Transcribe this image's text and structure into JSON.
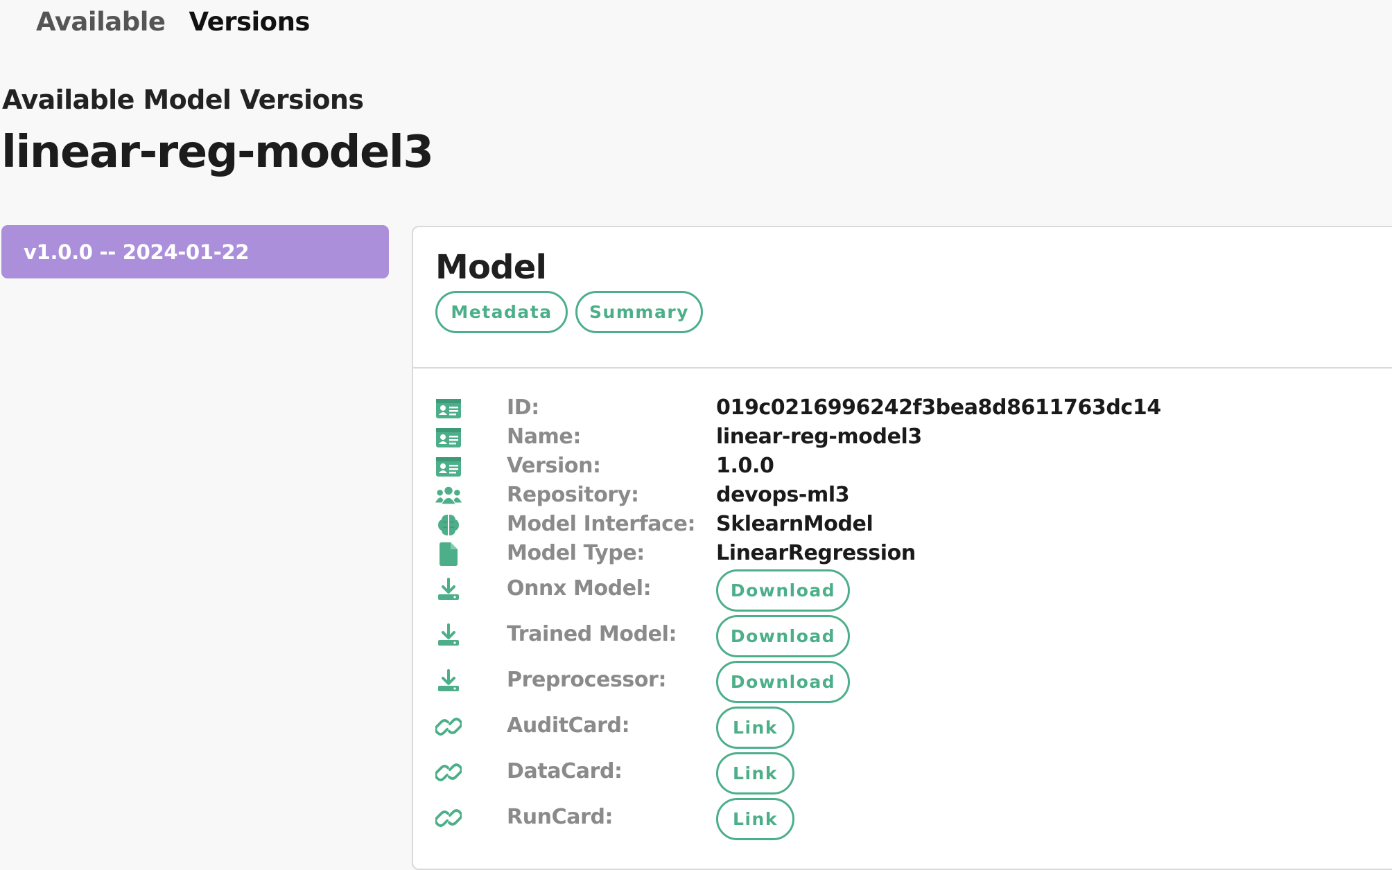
{
  "tabs": [
    {
      "label": "Available"
    },
    {
      "label": "Versions"
    }
  ],
  "page": {
    "subtitle": "Available Model Versions",
    "model_name": "linear-reg-model3"
  },
  "versions": [
    {
      "label": "v1.0.0 -- 2024-01-22",
      "selected": true
    }
  ],
  "card": {
    "title": "Model",
    "tabs": [
      {
        "label": "Metadata"
      },
      {
        "label": "Summary"
      }
    ],
    "fields": [
      {
        "icon": "id-card-icon",
        "label": "ID:",
        "value": "019c0216996242f3bea8d8611763dc14"
      },
      {
        "icon": "id-card-icon",
        "label": "Name:",
        "value": "linear-reg-model3"
      },
      {
        "icon": "id-card-icon",
        "label": "Version:",
        "value": "1.0.0"
      },
      {
        "icon": "users-icon",
        "label": "Repository:",
        "value": "devops-ml3"
      },
      {
        "icon": "brain-icon",
        "label": "Model Interface:",
        "value": "SklearnModel"
      },
      {
        "icon": "file-icon",
        "label": "Model Type:",
        "value": "LinearRegression"
      }
    ],
    "actions": [
      {
        "icon": "download-icon",
        "label": "Onnx Model:",
        "button": "Download"
      },
      {
        "icon": "download-icon",
        "label": "Trained Model:",
        "button": "Download"
      },
      {
        "icon": "download-icon",
        "label": "Preprocessor:",
        "button": "Download"
      },
      {
        "icon": "link-icon",
        "label": "AuditCard:",
        "button": "Link"
      },
      {
        "icon": "link-icon",
        "label": "DataCard:",
        "button": "Link"
      },
      {
        "icon": "link-icon",
        "label": "RunCard:",
        "button": "Link"
      }
    ]
  },
  "colors": {
    "accent_green": "#4caf8a",
    "selected_version_bg": "#ac8fdb",
    "label_gray": "#8a8a8a"
  }
}
